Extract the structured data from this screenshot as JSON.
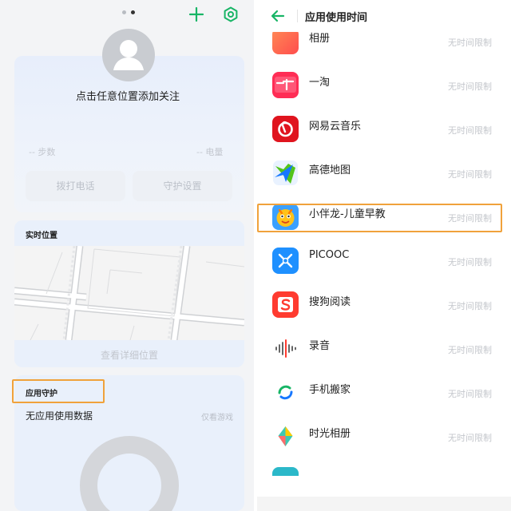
{
  "left": {
    "profile": {
      "add_follow": "点击任意位置添加关注",
      "steps": "-- 步数",
      "battery": "-- 电量",
      "call_button": "拨打电话",
      "guard_settings_button": "守护设置"
    },
    "location": {
      "title": "实时位置",
      "view_detail": "查看详细位置"
    },
    "app_guard": {
      "title": "应用守护",
      "no_data": "无应用使用数据",
      "only_games": "仅看游戏"
    },
    "icons": {
      "plus": "plus-icon",
      "settings": "settings-icon",
      "accent": "#18b566"
    }
  },
  "right": {
    "title": "应用使用时间",
    "back_icon": "back-arrow-icon",
    "apps": [
      {
        "name": "相册",
        "limit": "无时间限制",
        "icon": "photos-icon"
      },
      {
        "name": "一淘",
        "limit": "无时间限制",
        "icon": "yitao-icon"
      },
      {
        "name": "网易云音乐",
        "limit": "无时间限制",
        "icon": "netease-music-icon"
      },
      {
        "name": "高德地图",
        "limit": "无时间限制",
        "icon": "amap-icon"
      },
      {
        "name": "小伴龙-儿童早教",
        "limit": "无时间限制",
        "icon": "xiaobanlong-icon"
      },
      {
        "name": "PICOOC",
        "limit": "无时间限制",
        "icon": "picooc-icon"
      },
      {
        "name": "搜狗阅读",
        "limit": "无时间限制",
        "icon": "sogou-reader-icon"
      },
      {
        "name": "录音",
        "limit": "无时间限制",
        "icon": "recorder-icon"
      },
      {
        "name": "手机搬家",
        "limit": "无时间限制",
        "icon": "phone-clone-icon"
      },
      {
        "name": "时光相册",
        "limit": "无时间限制",
        "icon": "time-album-icon"
      }
    ]
  }
}
